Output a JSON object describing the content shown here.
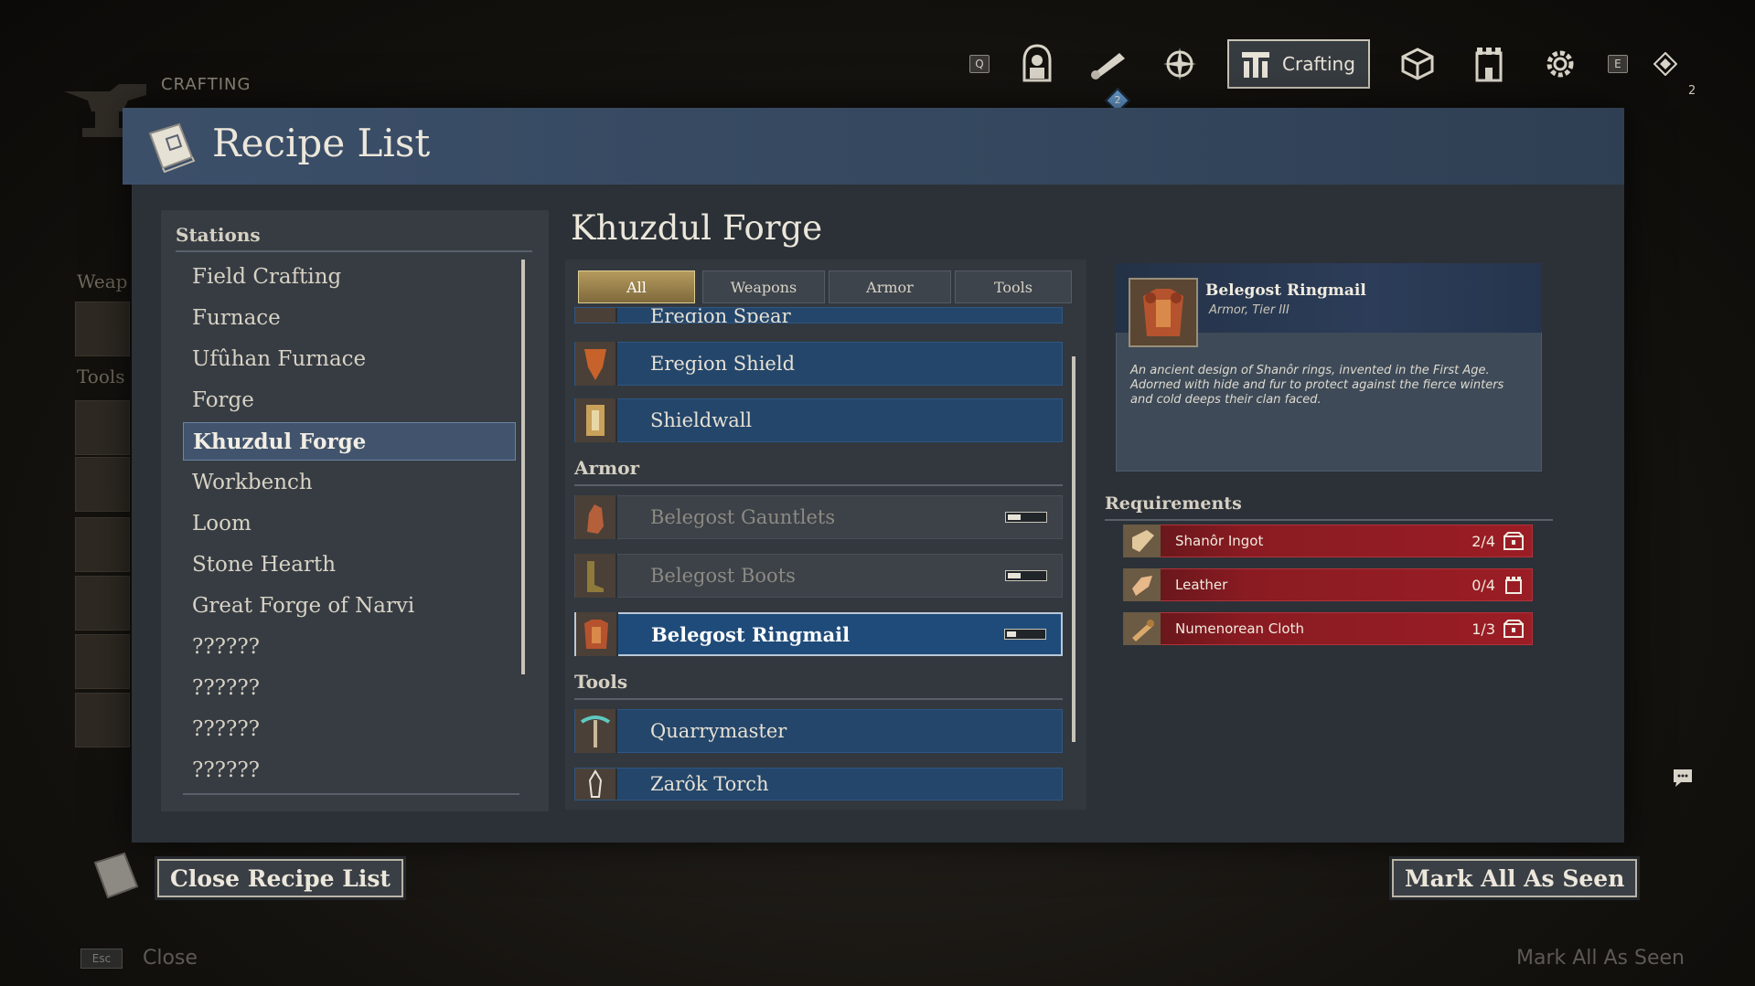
{
  "background": {
    "crafting_label": "CRAFTING",
    "weapons_label": "Weap",
    "tools_label": "Tools"
  },
  "nav": {
    "q_key": "Q",
    "e_key": "E",
    "active_label": "Crafting",
    "badge": "2",
    "count": "2",
    "icons": [
      "character-icon",
      "scroll-icon",
      "compass-icon",
      "crafting-icon",
      "blocks-icon",
      "fortress-icon",
      "gear-icon",
      "waypoint-icon"
    ]
  },
  "panel": {
    "title": "Recipe List"
  },
  "stations": {
    "heading": "Stations",
    "items": [
      "Field Crafting",
      "Furnace",
      "Ufûhan Furnace",
      "Forge",
      "Khuzdul Forge",
      "Workbench",
      "Loom",
      "Stone Hearth",
      "Great Forge of Narvi",
      "??????",
      "??????",
      "??????",
      "??????"
    ],
    "active_index": 4
  },
  "forge": {
    "title": "Khuzdul Forge",
    "tabs": [
      "All",
      "Weapons",
      "Armor",
      "Tools"
    ],
    "active_tab": "All",
    "partial_item": "Eregion Spear",
    "weapons": [
      "Eregion Shield",
      "Shieldwall"
    ],
    "armor_heading": "Armor",
    "armor": [
      {
        "name": "Belegost Gauntlets",
        "progress": 0.35
      },
      {
        "name": "Belegost Boots",
        "progress": 0.35
      },
      {
        "name": "Belegost Ringmail",
        "progress": 0.25
      }
    ],
    "tools_heading": "Tools",
    "tools": [
      "Quarrymaster",
      "Zarôk Torch"
    ]
  },
  "detail": {
    "name": "Belegost Ringmail",
    "subtitle": "Armor, Tier III",
    "description": "An ancient design of Shanôr rings, invented in the First Age. Adorned with hide and fur to protect against the fierce winters and cold deeps their clan faced.",
    "requirements_heading": "Requirements",
    "requirements": [
      {
        "name": "Shanôr Ingot",
        "count": "2/4"
      },
      {
        "name": "Leather",
        "count": "0/4"
      },
      {
        "name": "Numenorean Cloth",
        "count": "1/3"
      }
    ]
  },
  "footer": {
    "close_button": "Close Recipe List",
    "mark_button": "Mark All As Seen",
    "esc_key": "Esc",
    "close_hint": "Close",
    "mark_hint": "Mark All As Seen"
  },
  "colors": {
    "header_blue": "#3c4f69",
    "selected_blue": "#1f4b7a",
    "requirement_red": "#9b1d25",
    "tab_gold": "#b59a5e"
  }
}
